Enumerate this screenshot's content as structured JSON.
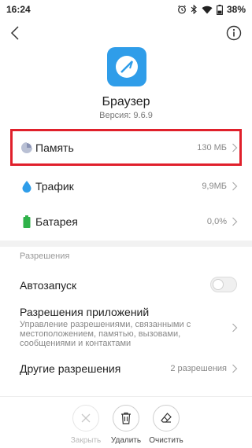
{
  "status_bar": {
    "time": "16:24",
    "battery_percent": "38%",
    "icons": [
      "alarm-icon",
      "bluetooth-icon",
      "wifi-icon",
      "battery-icon"
    ]
  },
  "header": {
    "back_icon": "chevron-left-icon",
    "info_icon": "info-icon"
  },
  "app": {
    "name": "Браузер",
    "version": "Версия: 9.6.9",
    "icon": "browser-app-icon",
    "icon_color": "#2f9de9"
  },
  "rows": [
    {
      "label": "Память",
      "value": "130 МБ",
      "icon": "pie-chart-icon"
    },
    {
      "label": "Трафик",
      "value": "9,9МБ",
      "icon": "drop-icon"
    },
    {
      "label": "Батарея",
      "value": "0,0%",
      "icon": "battery-icon"
    }
  ],
  "permissions": {
    "section_label": "Разрешения",
    "autostart_label": "Автозапуск",
    "autostart_enabled": false,
    "app_permissions_title": "Разрешения приложений",
    "app_permissions_desc": "Управление разрешениями, связанными с местоположением, памятью, вызовами, сообщениями и контактами",
    "other_label": "Другие разрешения",
    "other_value": "2 разрешения"
  },
  "actions": [
    {
      "label": "Закрыть",
      "icon": "close-icon",
      "enabled": false
    },
    {
      "label": "Удалить",
      "icon": "trash-icon",
      "enabled": true
    },
    {
      "label": "Очистить",
      "icon": "eraser-icon",
      "enabled": true
    }
  ],
  "colors": {
    "highlight": "#e0202b",
    "accent_blue": "#2f9de9",
    "battery_green": "#2fb24a"
  }
}
